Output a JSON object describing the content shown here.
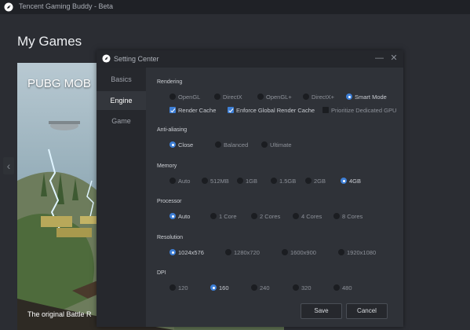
{
  "app": {
    "title": "Tencent Gaming Buddy - Beta"
  },
  "page": {
    "title": "My Games"
  },
  "game_card": {
    "title": "PUBG MOB",
    "caption": "The original Battle R"
  },
  "dialog": {
    "title": "Setting Center",
    "minimize_glyph": "—",
    "close_glyph": "✕",
    "nav": [
      {
        "label": "Basics",
        "active": false
      },
      {
        "label": "Engine",
        "active": true
      },
      {
        "label": "Game",
        "active": false
      }
    ],
    "sections": {
      "rendering": {
        "title": "Rendering",
        "modes": [
          {
            "label": "OpenGL",
            "selected": false
          },
          {
            "label": "DirectX",
            "selected": false
          },
          {
            "label": "OpenGL+",
            "selected": false
          },
          {
            "label": "DirectX+",
            "selected": false
          },
          {
            "label": "Smart Mode",
            "selected": true
          }
        ],
        "checkboxes": [
          {
            "label": "Render Cache",
            "checked": true
          },
          {
            "label": "Enforce Global Render Cache",
            "checked": true
          },
          {
            "label": "Prioritize Dedicated GPU",
            "checked": false
          }
        ]
      },
      "anti_aliasing": {
        "title": "Anti-aliasing",
        "options": [
          {
            "label": "Close",
            "selected": true
          },
          {
            "label": "Balanced",
            "selected": false
          },
          {
            "label": "Ultimate",
            "selected": false
          }
        ]
      },
      "memory": {
        "title": "Memory",
        "options": [
          {
            "label": "Auto",
            "selected": false
          },
          {
            "label": "512MB",
            "selected": false
          },
          {
            "label": "1GB",
            "selected": false
          },
          {
            "label": "1.5GB",
            "selected": false
          },
          {
            "label": "2GB",
            "selected": false
          },
          {
            "label": "4GB",
            "selected": true
          }
        ]
      },
      "processor": {
        "title": "Processor",
        "options": [
          {
            "label": "Auto",
            "selected": true
          },
          {
            "label": "1 Core",
            "selected": false
          },
          {
            "label": "2 Cores",
            "selected": false
          },
          {
            "label": "4 Cores",
            "selected": false
          },
          {
            "label": "8 Cores",
            "selected": false
          }
        ]
      },
      "resolution": {
        "title": "Resolution",
        "options": [
          {
            "label": "1024x576",
            "selected": true
          },
          {
            "label": "1280x720",
            "selected": false
          },
          {
            "label": "1600x900",
            "selected": false
          },
          {
            "label": "1920x1080",
            "selected": false
          }
        ]
      },
      "dpi": {
        "title": "DPI",
        "options": [
          {
            "label": "120",
            "selected": false
          },
          {
            "label": "160",
            "selected": true
          },
          {
            "label": "240",
            "selected": false
          },
          {
            "label": "320",
            "selected": false
          },
          {
            "label": "480",
            "selected": false
          }
        ]
      }
    },
    "buttons": {
      "save": "Save",
      "cancel": "Cancel"
    }
  },
  "colors": {
    "accent": "#3e7fd6",
    "window_bg": "#2b2d33",
    "dialog_bg": "#2f3238",
    "titlebar_bg": "#1f2126"
  }
}
